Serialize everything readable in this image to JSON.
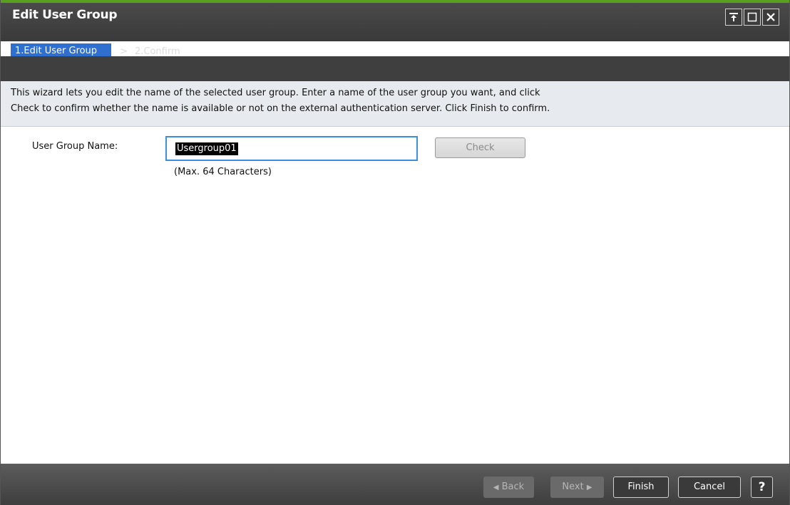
{
  "window": {
    "title": "Edit User Group",
    "controls": {
      "pin_icon": "pin-icon",
      "maximize_icon": "maximize-icon",
      "close_icon": "close-icon"
    }
  },
  "wizard": {
    "steps": [
      {
        "label": "1.Edit User Group",
        "active": true
      },
      {
        "label": "2.Confirm",
        "active": false
      }
    ],
    "separator": ">"
  },
  "description": {
    "line1": "This wizard lets you edit the name of the selected user group. Enter a name of the user group you want, and click",
    "line2": "Check to confirm whether the name is available or not on the external authentication server. Click Finish to confirm."
  },
  "form": {
    "user_group_name_label": "User Group Name:",
    "user_group_name_value": "Usergroup01",
    "check_label": "Check",
    "hint": "(Max. 64 Characters)"
  },
  "footer": {
    "back_label": "Back",
    "next_label": "Next",
    "finish_label": "Finish",
    "cancel_label": "Cancel",
    "help_label": "?"
  },
  "colors": {
    "accent": "#5aa01e",
    "step_active": "#2f6fcf",
    "input_focus": "#3b8fe0"
  }
}
